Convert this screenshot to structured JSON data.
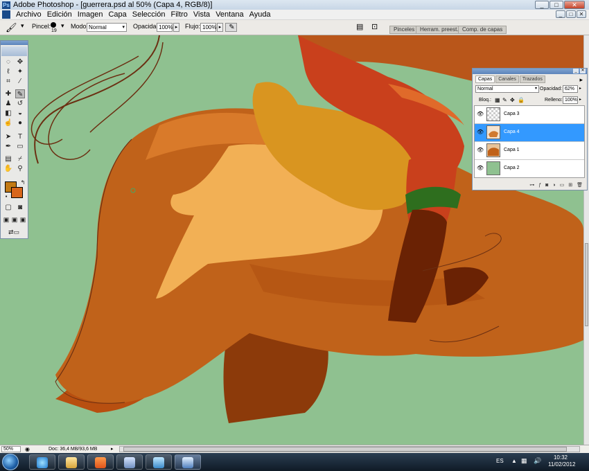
{
  "window": {
    "title": "Adobe Photoshop - [guerrera.psd al 50% (Capa 4, RGB/8)]",
    "minimize": "_",
    "maximize": "□",
    "close": "✕"
  },
  "menu": [
    "Archivo",
    "Edición",
    "Imagen",
    "Capa",
    "Selección",
    "Filtro",
    "Vista",
    "Ventana",
    "Ayuda"
  ],
  "options": {
    "brush_label": "Pincel:",
    "brush_size": "19",
    "mode_label": "Modo:",
    "mode_value": "Normal",
    "opacity_label": "Opacidad:",
    "opacity_value": "100%",
    "flow_label": "Flujo:",
    "flow_value": "100%",
    "palette_tabs": [
      "Pinceles",
      "Herram. preest.",
      "Comp. de capas"
    ]
  },
  "colors": {
    "foreground": "#c27a15",
    "background": "#d8661c",
    "canvas_bg": "#8fc190",
    "active_layer": "#3399ff"
  },
  "layers_panel": {
    "tabs": [
      "Capas",
      "Canales",
      "Trazados"
    ],
    "blend_mode": "Normal",
    "opacity_label": "Opacidad:",
    "opacity_value": "62%",
    "lock_label": "Bloq.:",
    "fill_label": "Relleno:",
    "fill_value": "100%",
    "layers": [
      {
        "name": "Capa 3",
        "active": false,
        "visible": true
      },
      {
        "name": "Capa 4",
        "active": true,
        "visible": true
      },
      {
        "name": "Capa 1",
        "active": false,
        "visible": true
      },
      {
        "name": "Capa 2",
        "active": false,
        "visible": true
      }
    ]
  },
  "status": {
    "zoom": "50%",
    "doc": "Doc: 36,4 MB/93,6 MB"
  },
  "taskbar": {
    "language": "ES",
    "time": "10:32",
    "date": "11/02/2012"
  }
}
